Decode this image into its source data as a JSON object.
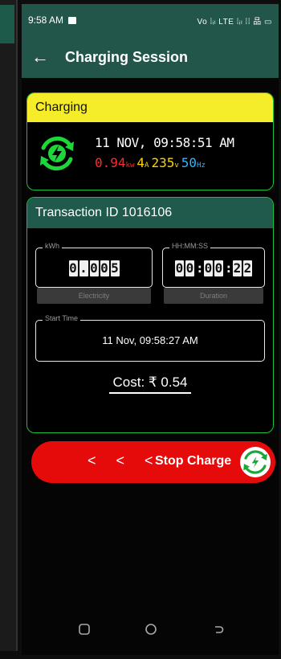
{
  "status": {
    "time": "9:58 AM",
    "right": "Vo ⁞ᵢₗ LTE ⁞ᵢₗ ⁞⁞ 品 ▭"
  },
  "appbar": {
    "title": "Charging Session",
    "back_icon": "arrow-left-icon"
  },
  "charging_card": {
    "header": "Charging",
    "header_color": "#f5ec2a",
    "date": "11 NOV, 09:58:51 AM",
    "power": {
      "value": "0.94",
      "unit": "kw",
      "color": "#ff2a2a"
    },
    "current": {
      "value": "4",
      "unit": "A",
      "color": "#ffd400"
    },
    "voltage": {
      "value": "235",
      "unit": "v",
      "color": "#ffd400"
    },
    "frequency": {
      "value": "50",
      "unit": "Hz",
      "color": "#2fb4ff"
    }
  },
  "transaction": {
    "header": "Transaction ID 1016106",
    "electricity": {
      "legend": "kWh",
      "digits": [
        "0",
        ".",
        "0",
        "0",
        "5"
      ],
      "label": "Electricity"
    },
    "duration": {
      "legend": "HH:MM:SS",
      "digits": [
        "0",
        "0",
        ":",
        "0",
        "0",
        ":",
        "2",
        "2"
      ],
      "label": "Duration"
    },
    "start_time": {
      "legend": "Start Time",
      "value": "11 Nov, 09:58:27 AM"
    },
    "cost": "Cost: ₹ 0.54"
  },
  "stop_button": {
    "arrows": "< < <",
    "label": "Stop Charge",
    "color": "#e50b0b"
  },
  "navbar": {
    "icons": [
      "recent-apps-icon",
      "home-icon",
      "back-icon"
    ]
  }
}
